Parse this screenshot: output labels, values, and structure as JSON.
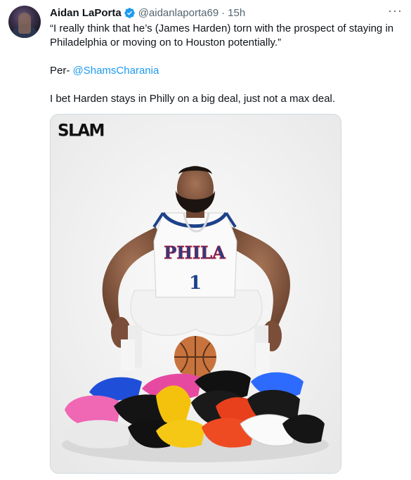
{
  "tweet": {
    "author_name": "Aidan LaPorta",
    "handle": "@aidanlaporta69",
    "separator": "·",
    "time": "15h",
    "more_glyph": "···",
    "line1": "“I really think that he’s (James Harden) torn with the prospect of staying in Philadelphia or moving on to Houston potentially.”",
    "per_prefix": "Per- ",
    "per_mention": "@ShamsCharania",
    "line3": "I bet Harden stays in Philly on a big deal, just not a max deal."
  },
  "media": {
    "logo_text": "SLAM",
    "jersey_text": "PHILA",
    "jersey_number": "1"
  },
  "colors": {
    "link": "#1d9bf0",
    "verified": "#1d9bf0",
    "muted": "#536471"
  }
}
